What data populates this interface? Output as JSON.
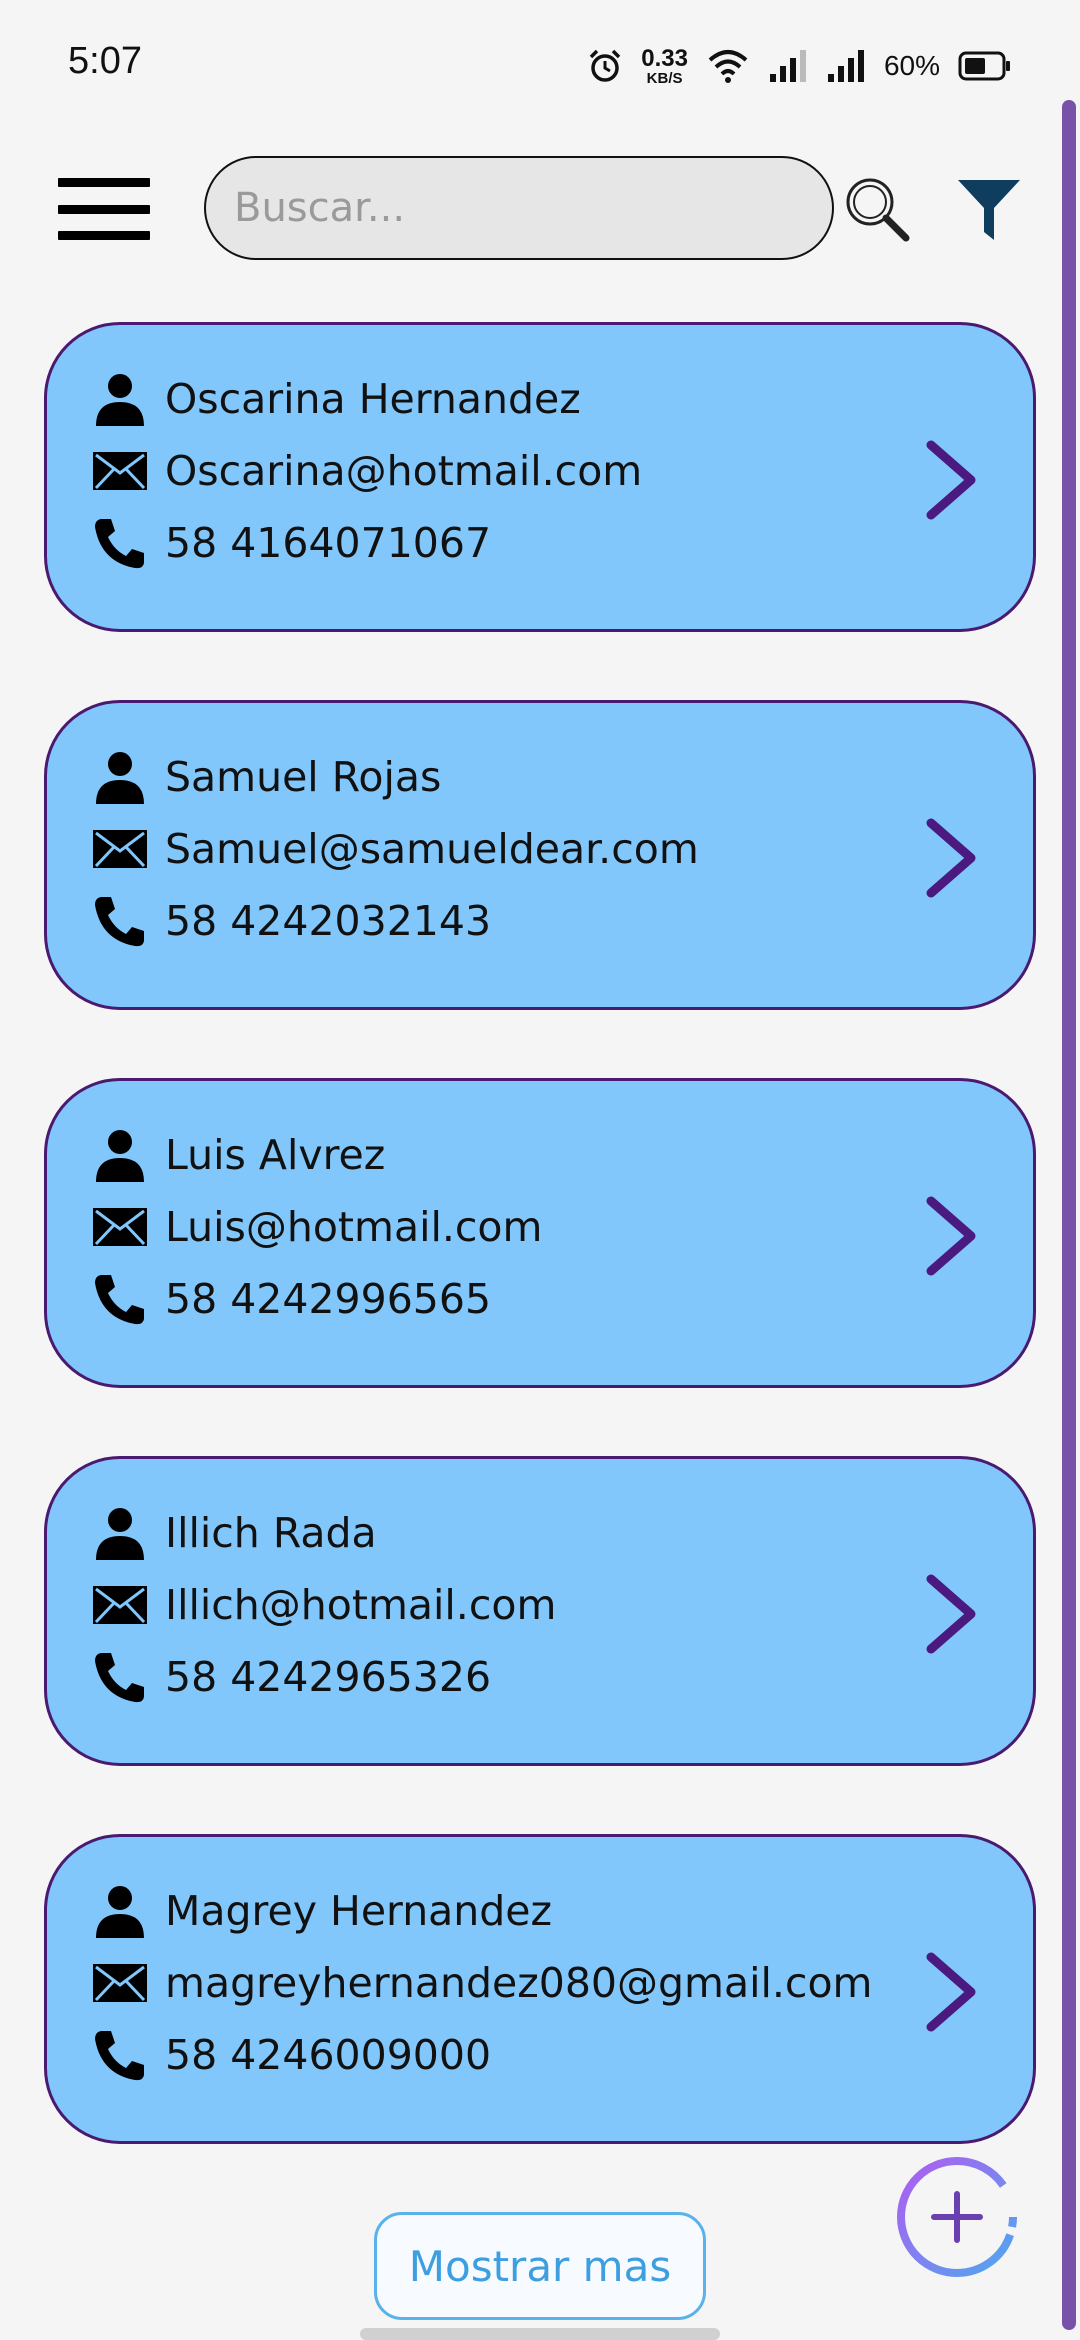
{
  "status_bar": {
    "time": "5:07",
    "net_speed_value": "0.33",
    "net_speed_unit": "KB/S",
    "battery": "60%"
  },
  "header": {
    "search_placeholder": "Buscar..."
  },
  "contacts": [
    {
      "name": "Oscarina Hernandez",
      "email": "Oscarina@hotmail.com",
      "phone": "58 4164071067"
    },
    {
      "name": "Samuel Rojas",
      "email": "Samuel@samueldear.com",
      "phone": "58 4242032143"
    },
    {
      "name": "Luis Alvrez",
      "email": "Luis@hotmail.com",
      "phone": "58 4242996565"
    },
    {
      "name": "Illich Rada",
      "email": "Illich@hotmail.com",
      "phone": "58 4242965326"
    },
    {
      "name": "Magrey Hernandez",
      "email": "magreyhernandez080@gmail.com",
      "phone": "58 4246009000"
    }
  ],
  "footer": {
    "show_more_label": "Mostrar mas"
  },
  "colors": {
    "card_bg": "#82c7fb",
    "card_border": "#4a1a70",
    "chevron": "#4a1a80",
    "filter": "#0e3d5e",
    "show_more": "#3d9ee0"
  }
}
